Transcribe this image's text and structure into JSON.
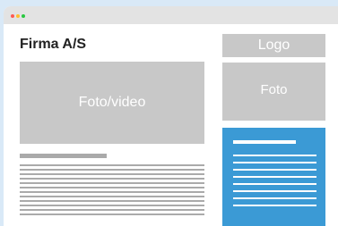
{
  "window": {
    "controls": [
      "close",
      "minimize",
      "maximize"
    ]
  },
  "header": {
    "company": "Firma A/S"
  },
  "media": {
    "video_label": "Foto/video"
  },
  "sidebar": {
    "logo_label": "Logo",
    "photo_label": "Foto"
  },
  "colors": {
    "background": "#d9e9f7",
    "placeholder": "#c8c8c8",
    "accent": "#3b9ad5",
    "text_lines": "#aaaaaa"
  },
  "body_text": {
    "line_count": 12
  },
  "card": {
    "line_count": 8
  }
}
